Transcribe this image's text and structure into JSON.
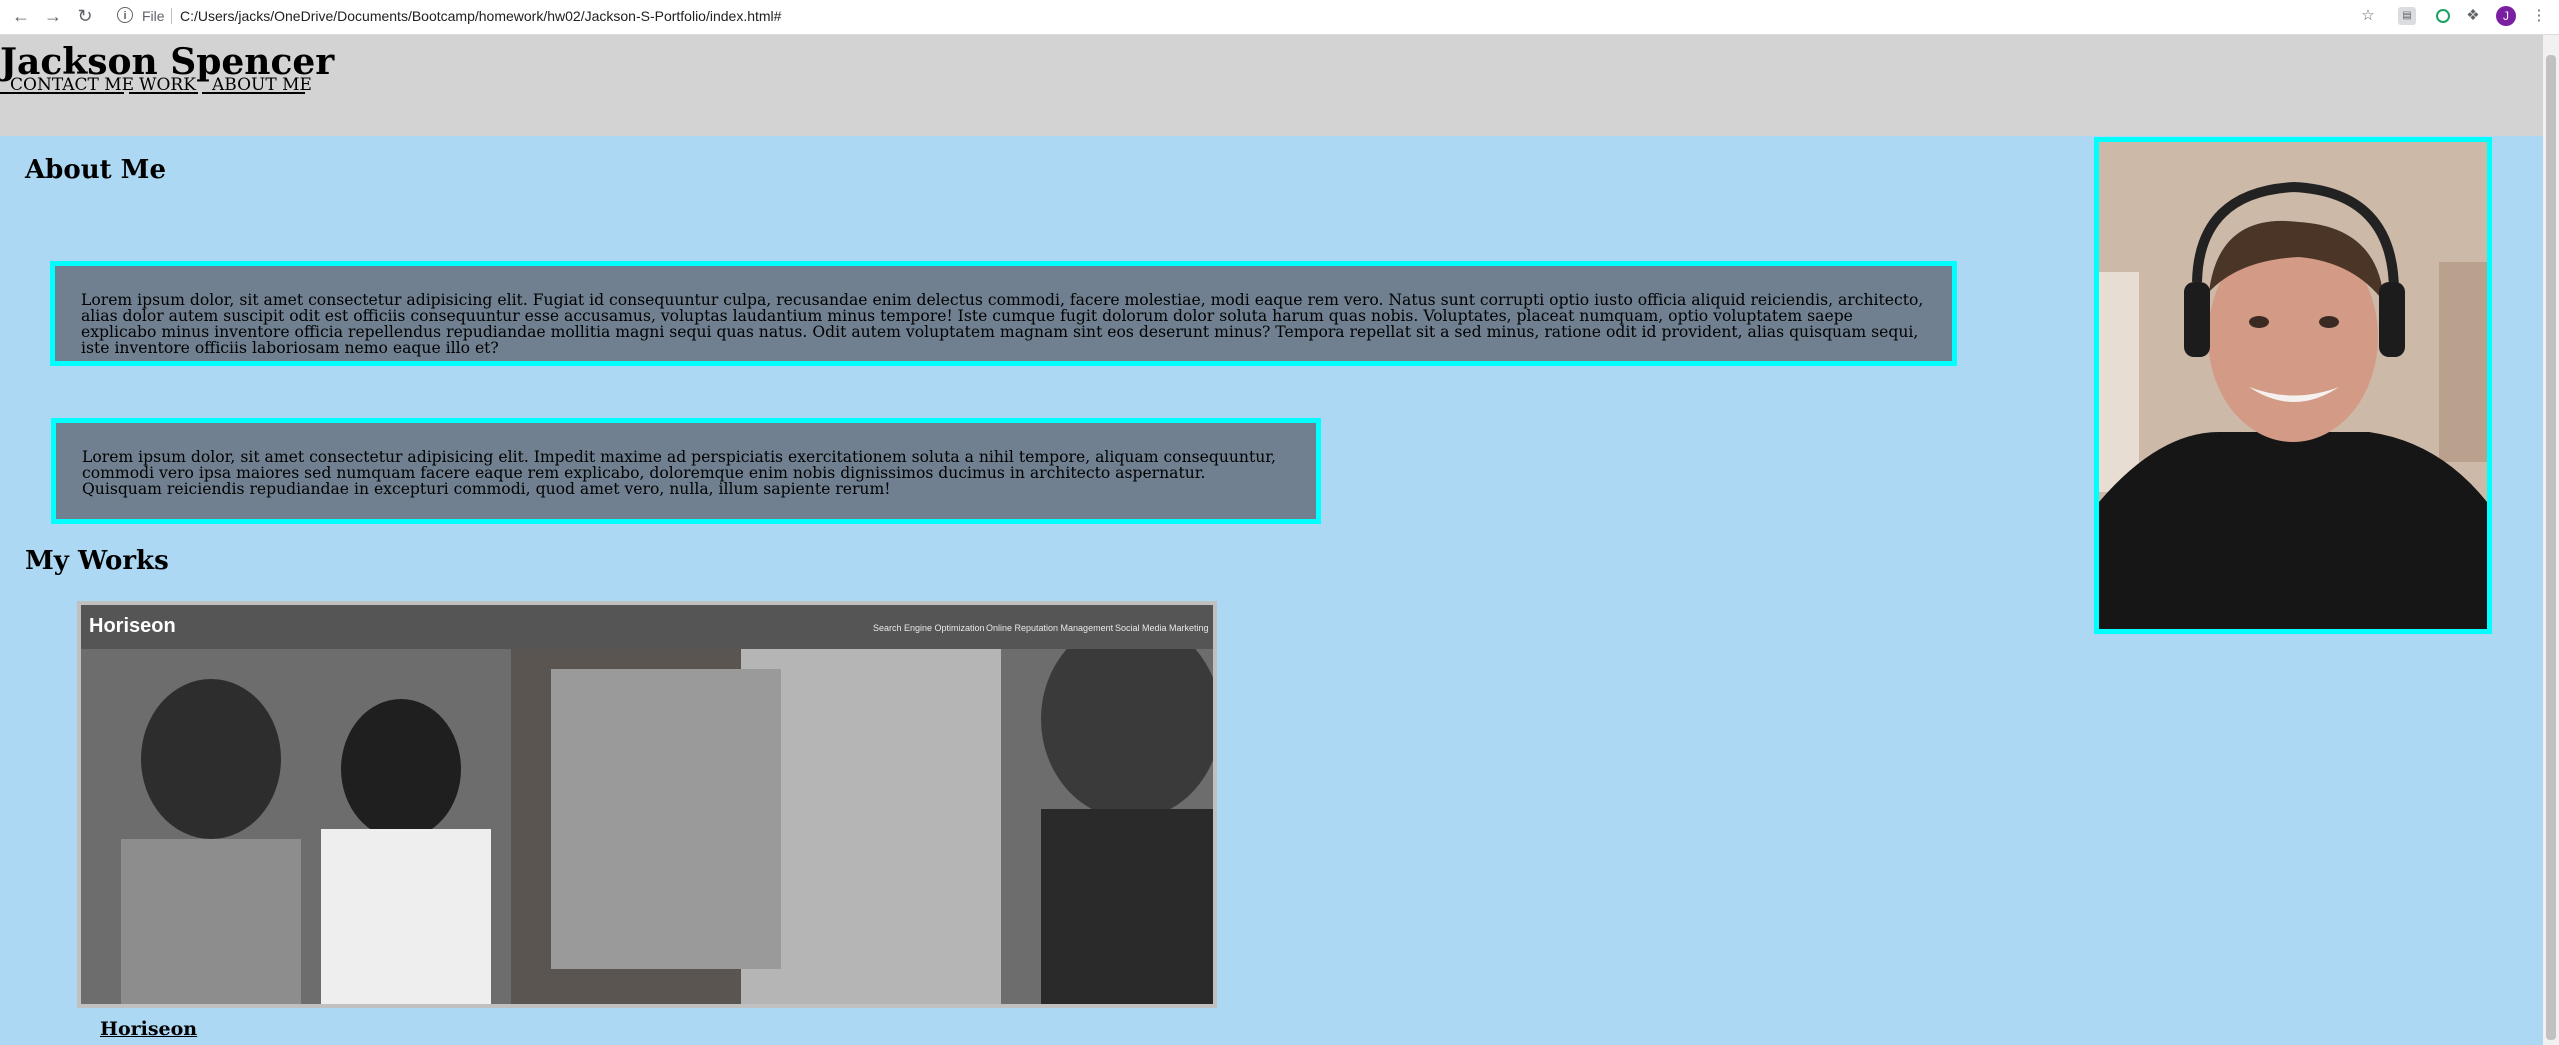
{
  "browser": {
    "url_scheme_label": "File",
    "url": "C:/Users/jacks/OneDrive/Documents/Bootcamp/homework/hw02/Jackson-S-Portfolio/index.html#",
    "profile_initial": "J"
  },
  "header": {
    "title": "Jackson Spencer",
    "nav": [
      "CONTACT ME",
      "WORK",
      "ABOUT ME"
    ]
  },
  "about": {
    "heading": "About Me",
    "paragraphs": [
      "Lorem ipsum dolor, sit amet consectetur adipisicing elit. Fugiat id consequuntur culpa, recusandae enim delectus commodi, facere molestiae, modi eaque rem vero. Natus sunt corrupti optio iusto officia aliquid reiciendis, architecto, alias dolor autem suscipit odit est officiis consequuntur esse accusamus, voluptas laudantium minus tempore! Iste cumque fugit dolorum dolor soluta harum quas nobis. Voluptates, placeat numquam, optio voluptatem saepe explicabo minus inventore officia repellendus repudiandae mollitia magni sequi quas natus. Odit autem voluptatem magnam sint eos deserunt minus? Tempora repellat sit a sed minus, ratione odit id provident, alias quisquam sequi, iste inventore officiis laboriosam nemo eaque illo et?",
      "Lorem ipsum dolor, sit amet consectetur adipisicing elit. Impedit maxime ad perspiciatis exercitationem soluta a nihil tempore, aliquam consequuntur, commodi vero ipsa maiores sed numquam facere eaque rem explicabo, doloremque enim nobis dignissimos ducimus in architecto aspernatur. Quisquam reiciendis repudiandae in excepturi commodi, quod amet vero, nulla, illum sapiente rerum!"
    ]
  },
  "works": {
    "heading": "My Works",
    "items": [
      {
        "title": "Horiseon",
        "preview_logo": "Horiseon",
        "preview_menu": [
          "Search Engine Optimization",
          "Online Reputation Management",
          "Social Media Marketing"
        ]
      }
    ]
  },
  "colors": {
    "page_bg": "#add8f3",
    "header_bg": "#d3d3d3",
    "box_bg": "#708090",
    "box_border": "#00ffff"
  }
}
